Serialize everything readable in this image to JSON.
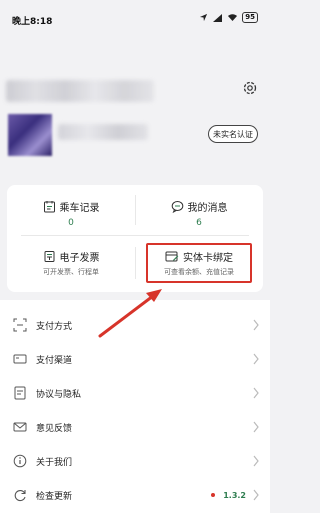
{
  "status_bar": {
    "time": "晚上8:18",
    "battery": "95"
  },
  "profile": {
    "verify_label": "未实名认证"
  },
  "grid": {
    "ride_records": {
      "label": "乘车记录",
      "count": "0"
    },
    "messages": {
      "label": "我的消息",
      "count": "6"
    },
    "invoice": {
      "label": "电子发票",
      "sub": "可开发票、行程单"
    },
    "card_bind": {
      "label": "实体卡绑定",
      "sub": "可查看余额、充值记录"
    }
  },
  "menu": {
    "items": [
      {
        "label": "支付方式",
        "icon": "payment-method-icon"
      },
      {
        "label": "支付渠道",
        "icon": "payment-channel-icon"
      },
      {
        "label": "协议与隐私",
        "icon": "agreement-icon"
      },
      {
        "label": "意见反馈",
        "icon": "feedback-mail-icon"
      },
      {
        "label": "关于我们",
        "icon": "info-icon"
      },
      {
        "label": "检查更新",
        "icon": "refresh-icon"
      }
    ],
    "version": "1.3.2"
  },
  "colors": {
    "accent": "#2e7d4f",
    "highlight": "#d7342a"
  }
}
